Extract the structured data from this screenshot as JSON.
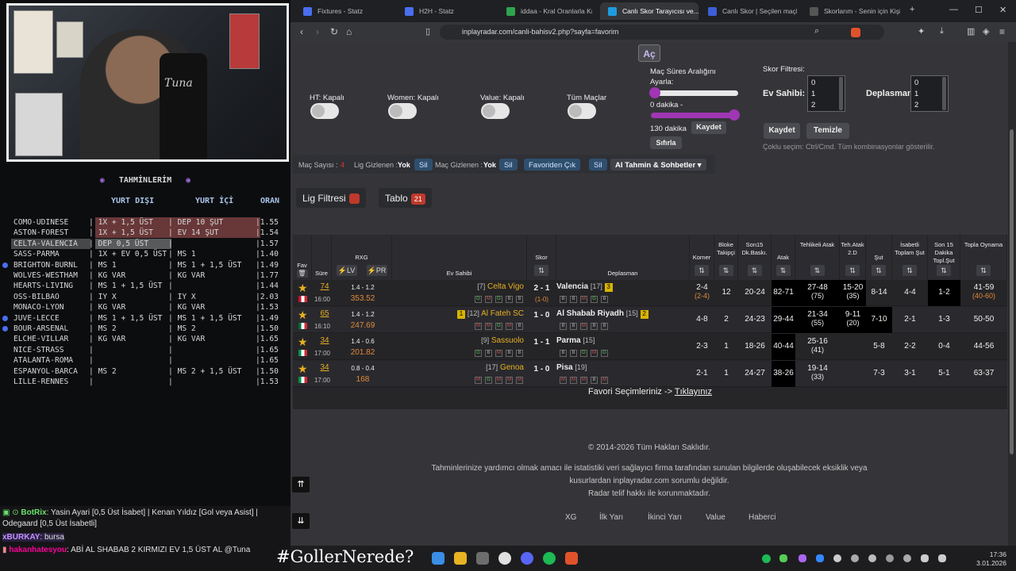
{
  "overlay": {
    "header": "TAHMİNLERİM",
    "cols": [
      "YURT DIŞI",
      "YURT İÇİ",
      "ORAN"
    ],
    "rows": [
      {
        "match": "COMO-UDINESE",
        "a": "1X + 1,5 ÜST",
        "b": "DEP 10 ŞUT",
        "o": "1.55"
      },
      {
        "match": "ASTON-FOREST",
        "a": "1X + 1,5 ÜST",
        "b": "EV 14 ŞUT",
        "o": "1.54"
      },
      {
        "match": "CELTA-VALENCIA",
        "a": "DEP 0,5 ÜST",
        "b": "",
        "o": "1.57"
      },
      {
        "match": "SASS-PARMA",
        "a": "1X + EV 0,5 ÜST",
        "b": "MS 1",
        "o": "1.40"
      },
      {
        "match": "BRIGHTON-BURNL",
        "a": "MS 1",
        "b": "MS 1 + 1,5 ÜST",
        "o": "1.49"
      },
      {
        "match": "WOLVES-WESTHAM",
        "a": "KG VAR",
        "b": "KG VAR",
        "o": "1.77"
      },
      {
        "match": "HEARTS-LIVING",
        "a": "MS 1 + 1,5 ÜST",
        "b": "",
        "o": "1.44"
      },
      {
        "match": "OSS-BILBAO",
        "a": "IY X",
        "b": "IY X",
        "o": "2.03"
      },
      {
        "match": "MONACO-LYON",
        "a": "KG VAR",
        "b": "KG VAR",
        "o": "1.53"
      },
      {
        "match": "JUVE-LECCE",
        "a": "MS 1 + 1,5 ÜST",
        "b": "MS 1 + 1,5 ÜST",
        "o": "1.49"
      },
      {
        "match": "BOUR-ARSENAL",
        "a": "MS 2",
        "b": "MS 2",
        "o": "1.50"
      },
      {
        "match": "ELCHE-VILLAR",
        "a": "KG VAR",
        "b": "KG VAR",
        "o": "1.65"
      },
      {
        "match": "NICE-STRASS",
        "a": "",
        "b": "",
        "o": "1.65"
      },
      {
        "match": "ATALANTA-ROMA",
        "a": "",
        "b": "",
        "o": "1.65"
      },
      {
        "match": "ESPANYOL-BARCA",
        "a": "MS 2",
        "b": "MS 2 + 1,5 ÜST",
        "o": "1.50"
      },
      {
        "match": "LILLE-RENNES",
        "a": "",
        "b": "",
        "o": "1.53"
      }
    ],
    "chat": [
      {
        "user": "BotRix",
        "msg": ": Yasin Ayari [0,5 Üst İsabet] | Kenan Yıldız [Gol veya Asist] |"
      },
      {
        "user": "",
        "msg": "Odegaard [0,5 Üst İsabetli]"
      },
      {
        "user": "xBURKAY",
        "msg": ": bursa"
      },
      {
        "user": "hakanhatesyou",
        "msg": ": ABİ AL SHABAB 2 KIRMIZI EV 1,5 ÜST AL @Tuna"
      }
    ],
    "tagline": "#GollerNerede?",
    "webcam_text": "Tuna"
  },
  "browser": {
    "tabs": [
      "Fixtures - Statz",
      "H2H - Statz",
      "iddaa - Kral Oranlarla Kral...",
      "Canlı Skor Tarayıcısı ve...",
      "Canlı Skor | Seçilen maçlar...",
      "Skorlarım - Senin için Kişisel..."
    ],
    "url": "inplayradar.com/canli-bahisv2.php?sayfa=favorim",
    "clock_time": "17:36",
    "clock_date": "3.01.2026"
  },
  "controls": {
    "open_btn": "Aç",
    "ht": "HT: Kapalı",
    "women": "Women: Kapalı",
    "value": "Value: Kapalı",
    "all": "Tüm Maçlar",
    "range_title": "Maç Süres Aralığını Ayarla:",
    "range_min": "0 dakika -",
    "range_max": "130 dakika",
    "save": "Kaydet",
    "reset": "Sıfırla",
    "score_title": "Skor Filtresi:",
    "home_lbl": "Ev Sahibi:",
    "away_lbl": "Deplasman:",
    "score_opts": [
      "0",
      "1",
      "2"
    ],
    "save2": "Kaydet",
    "clear": "Temizle",
    "hint": "Çoklu seçim: Ctrl/Cmd. Tüm kombinasyonlar gösterilir."
  },
  "filterbar": {
    "count_lbl": "Maç Sayısı :",
    "count": "4",
    "lig_hidden": "Lig Gizlenen :",
    "yok1": "Yok",
    "sil1": "Sil",
    "mac_hidden": "Maç Gizlenen :",
    "yok2": "Yok",
    "sil2": "Sil",
    "fav_out": "Favoriden Çık",
    "sil3": "Sil",
    "ai": "AI Tahmin & Sohbetler"
  },
  "tabs2": {
    "lig": "Lig Filtresi",
    "tablo": "Tablo",
    "tablo_count": "21"
  },
  "table": {
    "headers": {
      "fav": "Fav",
      "sure": "Süre",
      "rxg": "RXG",
      "lv": "LV",
      "pr": "PR",
      "home": "Ev Sahibi",
      "score": "Skor",
      "away": "Deplasman",
      "korner": "Korner",
      "bloke": "Bloke Takipçi",
      "son15": "Son15 Dk.Baskı.",
      "atak": "Atak",
      "tehlikeli": "Tehlikeli Atak",
      "teh2d": "Teh.Atak 2.D",
      "sut": "Şut",
      "isabetli": "İsabetli Toplam Şut",
      "son15sut": "Son 15 Dakika Topl.Şut",
      "topla": "Topla Oynama"
    },
    "rows": [
      {
        "min": "74",
        "time": "16:00",
        "rxg": "1.4 - 1.2",
        "pr_val": "353.52",
        "hrank": "[7]",
        "home": "Celta Vigo",
        "score": "2 - 1",
        "ht": "(1-0)",
        "away": "Valencia",
        "arank": "[17]",
        "acard": "3",
        "hform": [
          "G",
          "M",
          "G",
          "B",
          "B"
        ],
        "aform": [
          "B",
          "B",
          "M",
          "G",
          "B"
        ],
        "korner": "2-4",
        "korner2": "(2-4)",
        "bloke": "12",
        "son15": "20-24",
        "atak": "82-71",
        "teh": "27-48",
        "teh2": "(75)",
        "teh2d": "15-20",
        "teh2d2": "(35)",
        "sut": "8-14",
        "isa": "4-4",
        "s15": "1-2",
        "topla": "41-59",
        "topla2": "(40-60)"
      },
      {
        "min": "65",
        "time": "16:10",
        "rxg": "1.4 - 1.2",
        "pr_val": "247.69",
        "hrank": "[12]",
        "home": "Al Fateh SC",
        "hcard": "1",
        "score": "1 - 0",
        "ht": "",
        "away": "Al Shabab Riyadh",
        "arank": "[15]",
        "acard": "2",
        "hform": [
          "M",
          "M",
          "G",
          "M",
          "B"
        ],
        "aform": [
          "B",
          "B",
          "M",
          "B",
          "B"
        ],
        "korner": "4-8",
        "korner2": "",
        "bloke": "2",
        "son15": "24-23",
        "atak": "29-44",
        "teh": "21-34",
        "teh2": "(55)",
        "teh2d": "9-11",
        "teh2d2": "(20)",
        "sut": "7-10",
        "isa": "2-1",
        "s15": "1-3",
        "topla": "50-50",
        "topla2": ""
      },
      {
        "min": "34",
        "time": "17:00",
        "rxg": "1.4 - 0.6",
        "pr_val": "201.82",
        "hrank": "[9]",
        "home": "Sassuolo",
        "score": "1 - 1",
        "ht": "",
        "away": "Parma",
        "arank": "[15]",
        "hform": [
          "G",
          "B",
          "M",
          "B",
          "B"
        ],
        "aform": [
          "B",
          "B",
          "G",
          "M",
          "G"
        ],
        "korner": "2-3",
        "korner2": "",
        "bloke": "1",
        "son15": "18-26",
        "atak": "40-44",
        "teh": "25-16",
        "teh2": "(41)",
        "teh2d": "",
        "teh2d2": "",
        "sut": "5-8",
        "isa": "2-2",
        "s15": "0-4",
        "topla": "44-56",
        "topla2": ""
      },
      {
        "min": "34",
        "time": "17:00",
        "rxg": "0.8 - 0.4",
        "pr_val": "168",
        "hrank": "[17]",
        "home": "Genoa",
        "score": "1 - 0",
        "ht": "",
        "away": "Pisa",
        "arank": "[19]",
        "hform": [
          "M",
          "G",
          "M",
          "M",
          "M"
        ],
        "aform": [
          "M",
          "M",
          "M",
          "B",
          "M"
        ],
        "korner": "2-1",
        "korner2": "",
        "bloke": "1",
        "son15": "24-27",
        "atak": "38-26",
        "teh": "19-14",
        "teh2": "(33)",
        "teh2d": "",
        "teh2d2": "",
        "sut": "7-3",
        "isa": "3-1",
        "s15": "5-1",
        "topla": "63-37",
        "topla2": ""
      }
    ],
    "fav_line": "Favori Seçimleriniz ->",
    "fav_link": "Tıklayınız"
  },
  "footer": {
    "copy": "© 2014-2026 Tüm Hakları Saklıdır.",
    "l1": "Tahminlerinize yardımcı olmak amacı ile istatistiki veri sağlayıcı firma tarafından sunulan bilgilerde oluşabilecek eksiklik veya",
    "l2": "kusurlardan inplayradar.com sorumlu değildir.",
    "l3": "Radar telif hakkı ile korunmaktadır.",
    "links": [
      "XG",
      "İlk Yarı",
      "İkinci Yarı",
      "Value",
      "Haberci"
    ]
  },
  "colors": {
    "accent": "#a036b4",
    "row_hl": "#d96a6a",
    "card_yellow": "#d8b400",
    "dark_cell": "#000000"
  }
}
